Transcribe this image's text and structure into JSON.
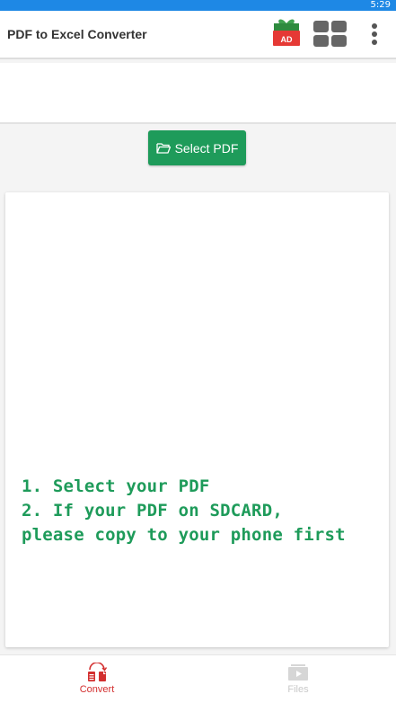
{
  "status_bar": {
    "time": "5:29",
    "color": "#1e88e5"
  },
  "toolbar": {
    "title": "PDF to Excel Converter",
    "ad_badge": "AD",
    "icons": [
      "gift-ad-icon",
      "grid-apps-icon",
      "more-vert-icon"
    ]
  },
  "main": {
    "select_button_label": "Select PDF",
    "select_button_icon": "folder-open-icon",
    "accent_color": "#1e9b5a",
    "instructions": [
      "1. Select your PDF",
      "2. If your PDF on SDCARD,",
      "please copy to your phone first"
    ]
  },
  "bottom_nav": {
    "items": [
      {
        "label": "Convert",
        "icon": "convert-icon",
        "active": true,
        "color": "#d32f2f"
      },
      {
        "label": "Files",
        "icon": "files-icon",
        "active": false,
        "color": "#c9c9c9"
      }
    ]
  }
}
